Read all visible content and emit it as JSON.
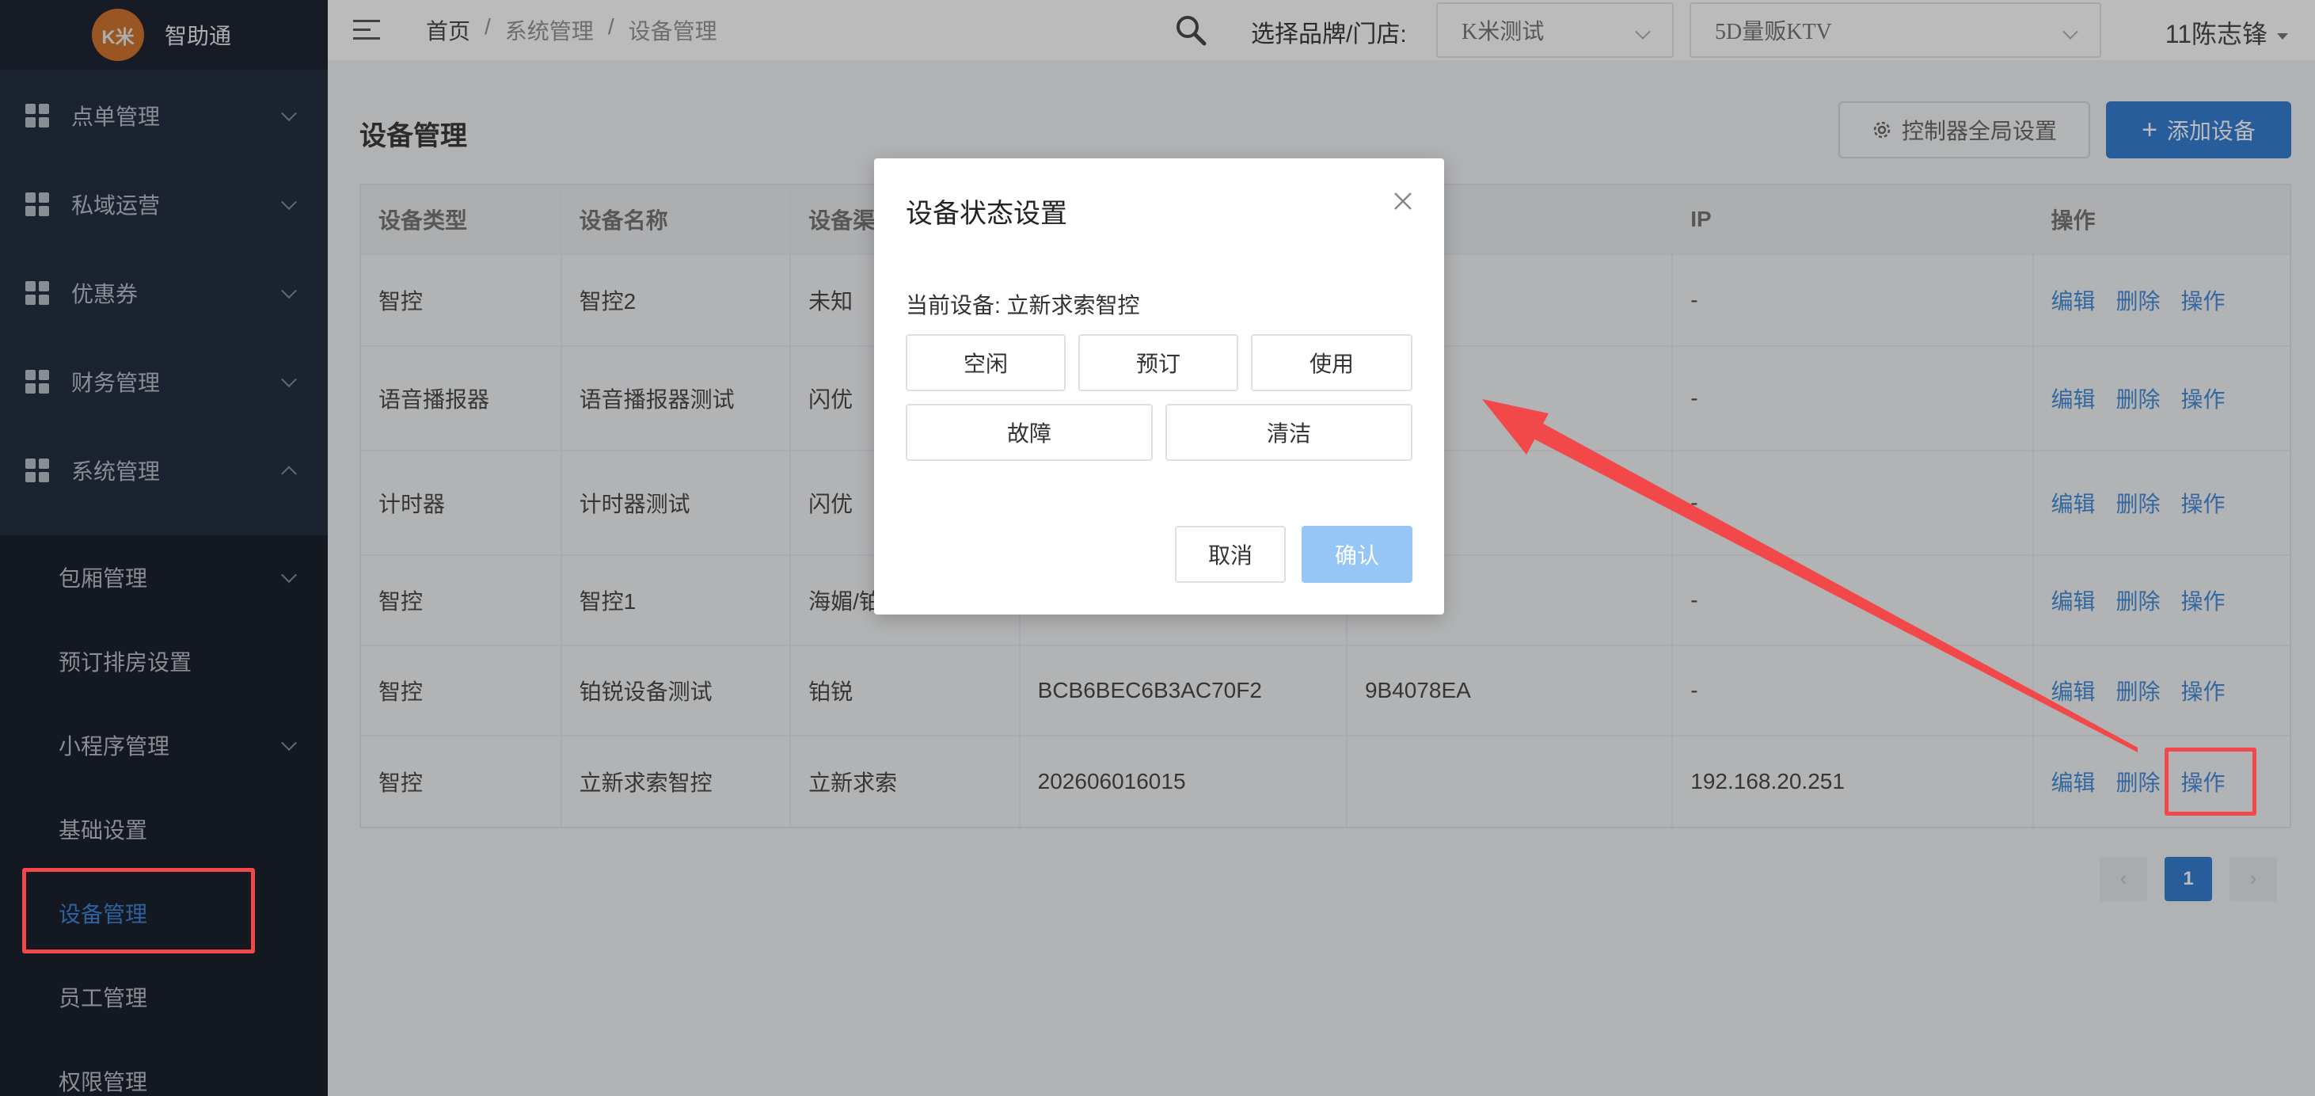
{
  "app": {
    "logo_badge": "K米",
    "logo_text": "智助通"
  },
  "sidebar": {
    "items": [
      {
        "label": "点单管理"
      },
      {
        "label": "私域运营"
      },
      {
        "label": "优惠券"
      },
      {
        "label": "财务管理"
      },
      {
        "label": "系统管理"
      }
    ],
    "submenu": [
      {
        "label": "包厢管理"
      },
      {
        "label": "预订排房设置"
      },
      {
        "label": "小程序管理"
      },
      {
        "label": "基础设置"
      },
      {
        "label": "设备管理"
      },
      {
        "label": "员工管理"
      },
      {
        "label": "权限管理"
      }
    ]
  },
  "header": {
    "breadcrumb": [
      "首页",
      "/",
      "系统管理",
      "/",
      "设备管理"
    ],
    "brand_label": "选择品牌/门店:",
    "brand_select": "K米测试",
    "store_select": "5D量贩KTV",
    "user": "11陈志锋"
  },
  "main": {
    "title": "设备管理",
    "global_settings": "控制器全局设置",
    "add_device": "添加设备",
    "columns": [
      "设备类型",
      "设备名称",
      "设备渠",
      "",
      "",
      "IP",
      "操作"
    ],
    "rows": [
      [
        "智控",
        "智控2",
        "未知",
        "",
        "",
        "-"
      ],
      [
        "语音播报器",
        "语音播报器测试",
        "闪优",
        "",
        "",
        "-"
      ],
      [
        "计时器",
        "计时器测试",
        "闪优",
        "",
        "",
        "-"
      ],
      [
        "智控",
        "智控1",
        "海媚/铂",
        "",
        "",
        "-"
      ],
      [
        "智控",
        "铂锐设备测试",
        "铂锐",
        "BCB6BEC6B3AC70F2",
        "9B4078EA",
        "-"
      ],
      [
        "智控",
        "立新求索智控",
        "立新求索",
        "202606016015",
        "",
        "192.168.20.251"
      ]
    ],
    "actions": {
      "edit": "编辑",
      "delete": "删除",
      "operate": "操作"
    },
    "pager": {
      "prev": "‹",
      "current": "1",
      "next": "›"
    }
  },
  "modal": {
    "title": "设备状态设置",
    "current_label": "当前设备: 立新求索智控",
    "states": [
      "空闲",
      "预订",
      "使用",
      "故障",
      "清洁"
    ],
    "cancel": "取消",
    "confirm": "确认"
  },
  "colors": {
    "primary": "#1e6fce",
    "highlight": "#f2484a",
    "sidebar": "#1f2a40"
  }
}
